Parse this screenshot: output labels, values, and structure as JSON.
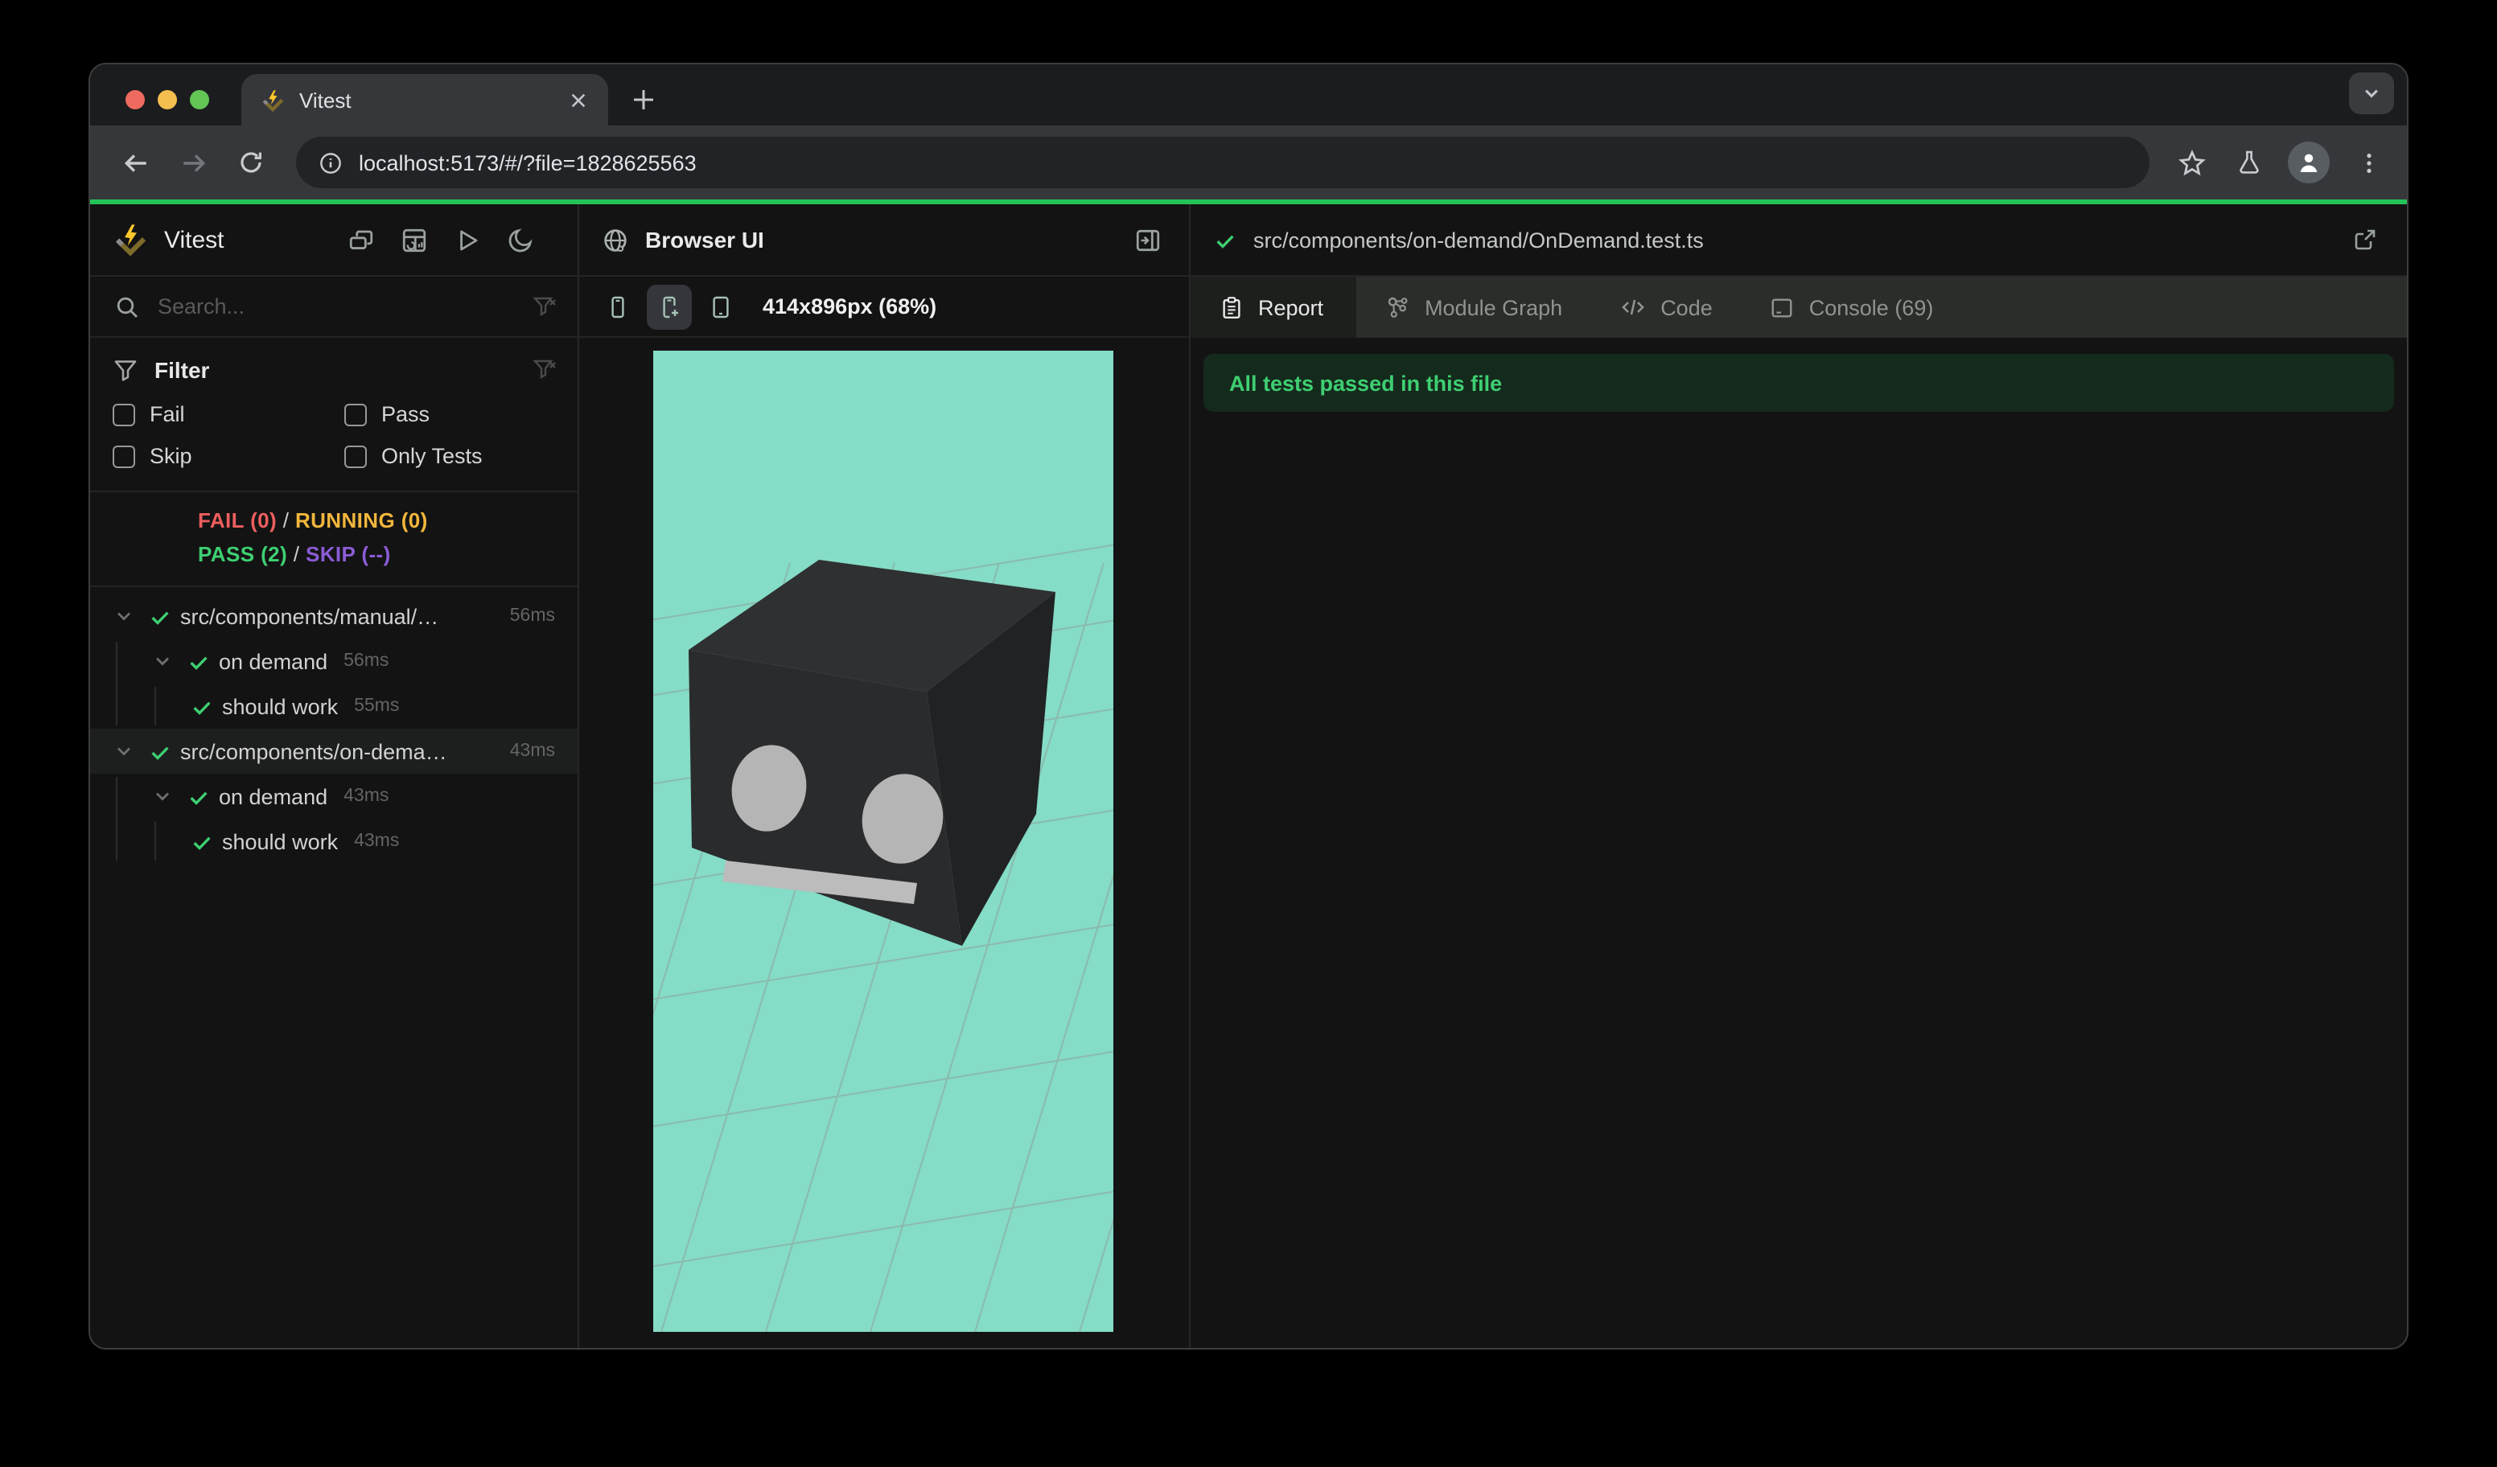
{
  "browser": {
    "tab_title": "Vitest",
    "url": "localhost:5173/#/?file=1828625563"
  },
  "sidebar": {
    "app_title": "Vitest",
    "search_placeholder": "Search...",
    "filter": {
      "title": "Filter",
      "options": [
        {
          "label": "Fail",
          "checked": false
        },
        {
          "label": "Pass",
          "checked": false
        },
        {
          "label": "Skip",
          "checked": false
        },
        {
          "label": "Only Tests",
          "checked": false
        }
      ]
    },
    "summary": {
      "fail": "FAIL (0)",
      "running": "RUNNING (0)",
      "pass": "PASS (2)",
      "skip": "SKIP (--)",
      "sep": "/"
    },
    "tree": [
      {
        "label": "src/components/manual/…",
        "duration": "56ms",
        "level": 0,
        "status": "pass"
      },
      {
        "label": "on demand",
        "duration": "56ms",
        "level": 1,
        "status": "pass"
      },
      {
        "label": "should work",
        "duration": "55ms",
        "level": 2,
        "status": "pass"
      },
      {
        "label": "src/components/on-dema…",
        "duration": "43ms",
        "level": 0,
        "status": "pass",
        "selected": true
      },
      {
        "label": "on demand",
        "duration": "43ms",
        "level": 1,
        "status": "pass"
      },
      {
        "label": "should work",
        "duration": "43ms",
        "level": 2,
        "status": "pass"
      }
    ]
  },
  "browser_panel": {
    "title": "Browser UI",
    "viewport": "414x896px (68%)"
  },
  "report_panel": {
    "file_path": "src/components/on-demand/OnDemand.test.ts",
    "tabs": [
      {
        "label": "Report",
        "active": true
      },
      {
        "label": "Module Graph",
        "active": false
      },
      {
        "label": "Code",
        "active": false
      },
      {
        "label": "Console (69)",
        "active": false
      }
    ],
    "banner": "All tests passed in this file"
  },
  "colors": {
    "accent_green": "#24c358",
    "pass_green": "#3ecf72",
    "fail_red": "#ed5e5e",
    "running_amber": "#f2b63c",
    "skip_purple": "#8a5cd6",
    "brand_yellow": "#fcc72b",
    "preview_background": "#85dcc7"
  }
}
